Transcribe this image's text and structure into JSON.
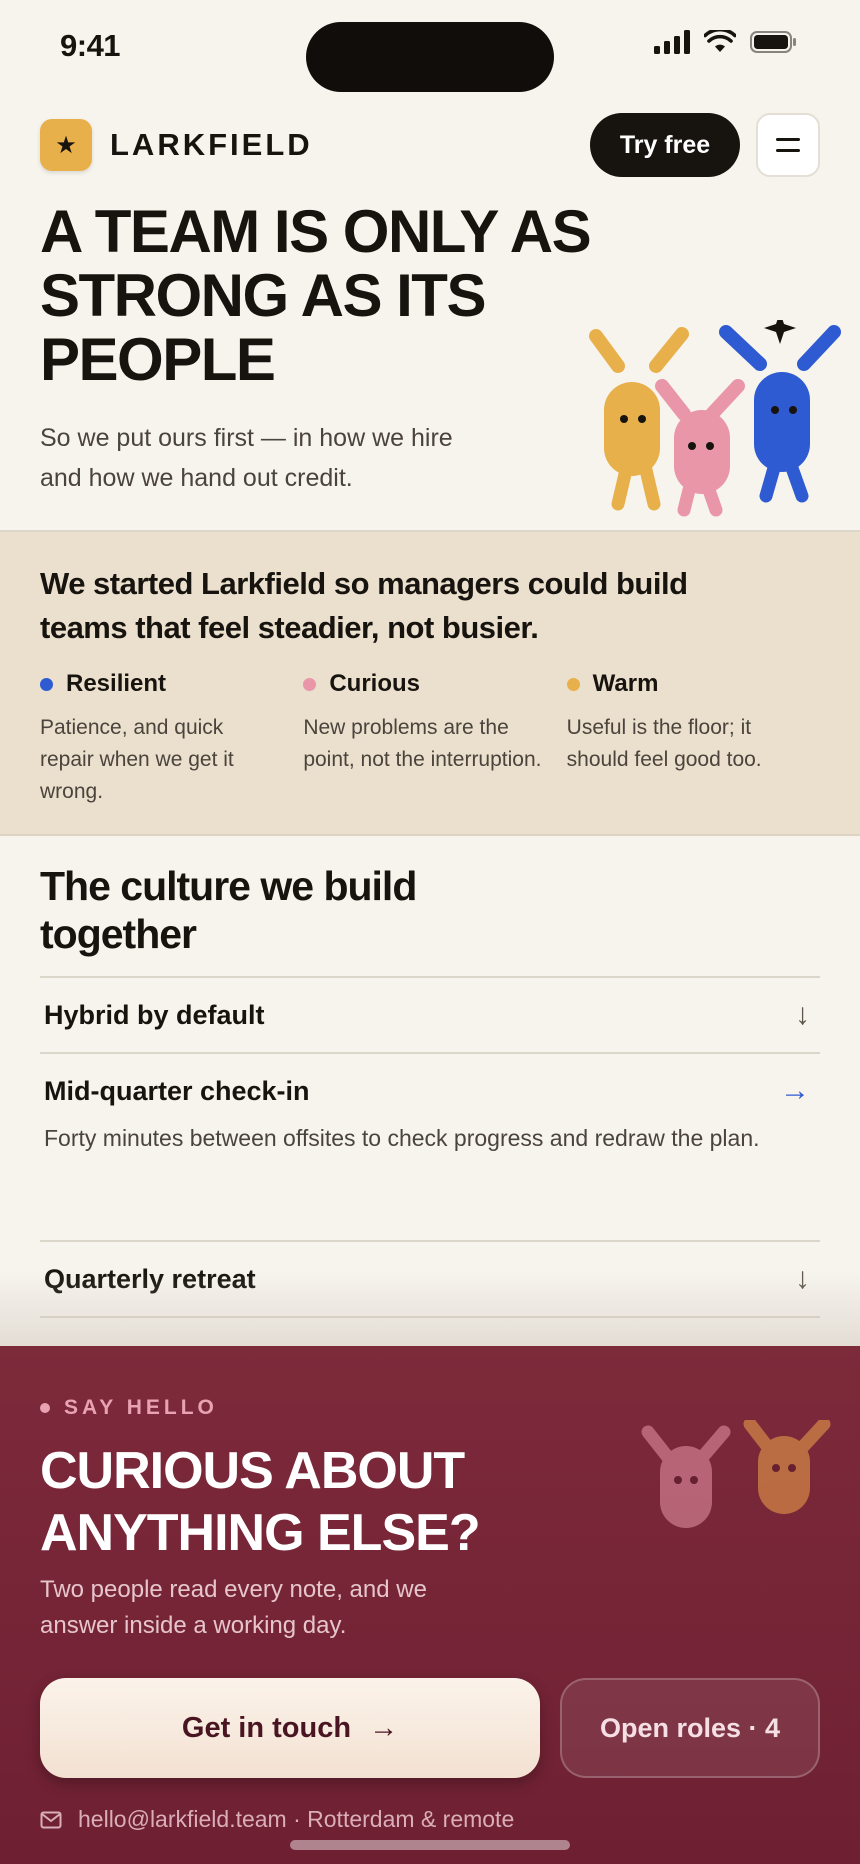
{
  "status_bar": {
    "time": "9:41"
  },
  "header": {
    "logo_icon": "star-icon",
    "brand": "LARKFIELD",
    "cta_label": "Try free",
    "menu_icon": "hamburger-icon"
  },
  "hero": {
    "title": "A TEAM IS ONLY AS STRONG AS ITS PEOPLE",
    "subtitle": "So we put ours first — in how we hire and how we hand out credit."
  },
  "values_band": {
    "title": "We started Larkfield so managers could build teams that feel steadier, not busier.",
    "items": [
      {
        "name": "Resilient",
        "desc": "Patience, and quick repair when we get it wrong.",
        "color": "#2f5bd2"
      },
      {
        "name": "Curious",
        "desc": "New problems are the point, not the interruption.",
        "color": "#e896a8"
      },
      {
        "name": "Warm",
        "desc": "Useful is the floor; it should feel good too.",
        "color": "#e8b04a"
      }
    ]
  },
  "culture": {
    "title": "The culture we build together",
    "items": [
      {
        "label": "Hybrid by default",
        "icon": "arrow-down-icon"
      },
      {
        "label": "Mid-quarter check-in",
        "icon": "arrow-right-icon",
        "body": "Forty minutes between offsites to check progress and redraw the plan.",
        "expanded": true
      },
      {
        "label": "Quarterly retreat",
        "icon": "arrow-down-icon"
      }
    ]
  },
  "contact_sheet": {
    "eyebrow": "SAY HELLO",
    "title": "CURIOUS ABOUT ANYTHING ELSE?",
    "subtitle": "Two people read every note, and we answer inside a working day.",
    "primary_cta": "Get in touch",
    "secondary_cta": "Open roles · 4",
    "contact_line": "hello@larkfield.team · Rotterdam & remote",
    "mail_icon": "mail-icon"
  },
  "colors": {
    "accent_yellow": "#e8b04a",
    "accent_pink": "#e896a8",
    "accent_blue": "#2f5bd2",
    "sheet_bg": "#7d2a3b"
  }
}
